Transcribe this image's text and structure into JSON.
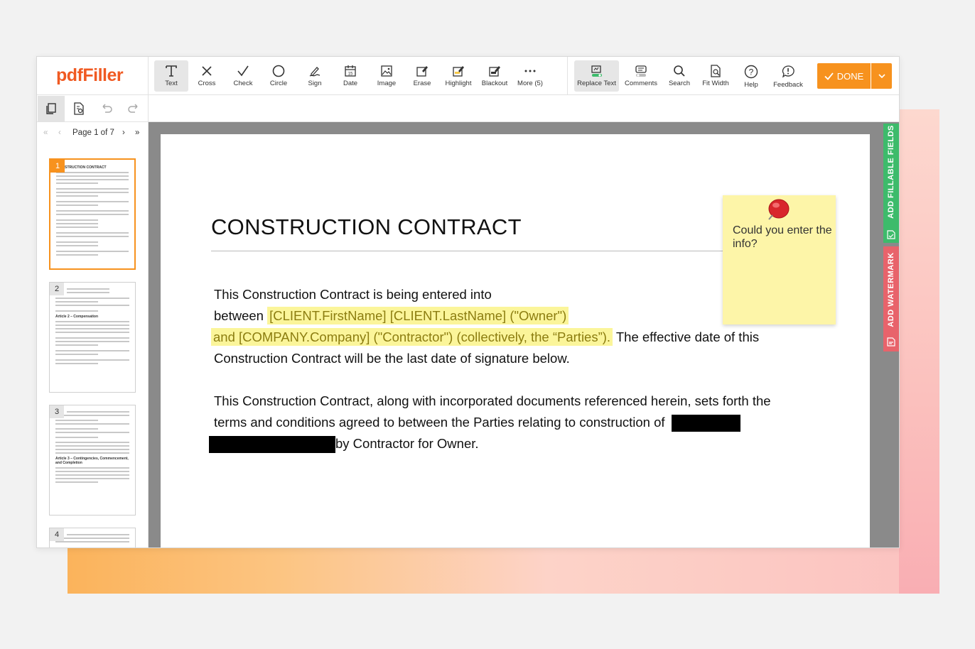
{
  "app": {
    "logo_text": "pdfFiller",
    "brand_color": "#f05a22",
    "accent_color": "#f7921e"
  },
  "toolbar": {
    "tools": [
      {
        "label": "Text",
        "icon": "text-icon"
      },
      {
        "label": "Cross",
        "icon": "cross-icon"
      },
      {
        "label": "Check",
        "icon": "check-icon"
      },
      {
        "label": "Circle",
        "icon": "circle-icon"
      },
      {
        "label": "Sign",
        "icon": "sign-icon"
      },
      {
        "label": "Date",
        "icon": "calendar-icon"
      },
      {
        "label": "Image",
        "icon": "image-icon"
      },
      {
        "label": "Erase",
        "icon": "erase-icon"
      },
      {
        "label": "Highlight",
        "icon": "highlight-icon"
      },
      {
        "label": "Blackout",
        "icon": "blackout-icon"
      },
      {
        "label": "More (5)",
        "icon": "more-icon"
      }
    ],
    "right_tools": [
      {
        "label": "Replace Text",
        "icon": "replace-text-icon"
      },
      {
        "label": "Comments",
        "icon": "comments-icon"
      },
      {
        "label": "Search",
        "icon": "search-icon"
      },
      {
        "label": "Fit Width",
        "icon": "fit-width-icon"
      },
      {
        "label": "Help",
        "icon": "help-icon"
      },
      {
        "label": "Feedback",
        "icon": "feedback-icon"
      }
    ],
    "done_label": "DONE"
  },
  "pager": {
    "label": "Page",
    "current": "1",
    "of_label": "of 7"
  },
  "thumbnails": [
    {
      "num": "1",
      "heading": "STRUCTION CONTRACT"
    },
    {
      "num": "2",
      "heading": "Article 2 – Compensation"
    },
    {
      "num": "3",
      "heading": "Article 3 – Contingencies, Commencement, and Completion"
    },
    {
      "num": "4",
      "heading": ""
    }
  ],
  "document": {
    "title": "CONSTRUCTION CONTRACT",
    "p1_line1": "This Construction Contract is being entered into",
    "p1_line2_pre": "between",
    "p1_line2_hl": "[CLIENT.FirstName] [CLIENT.LastName] (\"Owner\")",
    "p1_line3_hl": "and [COMPANY.Company] (\"Contractor\") (collectively, the “Parties”).",
    "p1_line3_post": "The effective date of this",
    "p1_line4": "Construction Contract will be the last date of signature below.",
    "p2_line1": "This Construction Contract, along with incorporated documents referenced herein, sets forth the",
    "p2_line2": "terms and conditions agreed to between the Parties relating to construction of",
    "p2_line3_post": "by Contractor for Owner."
  },
  "sticky_note": {
    "text": "Could you enter the info?"
  },
  "rail": {
    "fillable_label": "ADD FILLABLE FIELDS",
    "fillable_color": "#3dbb6b",
    "watermark_label": "ADD WATERMARK",
    "watermark_color": "#e8636b"
  }
}
